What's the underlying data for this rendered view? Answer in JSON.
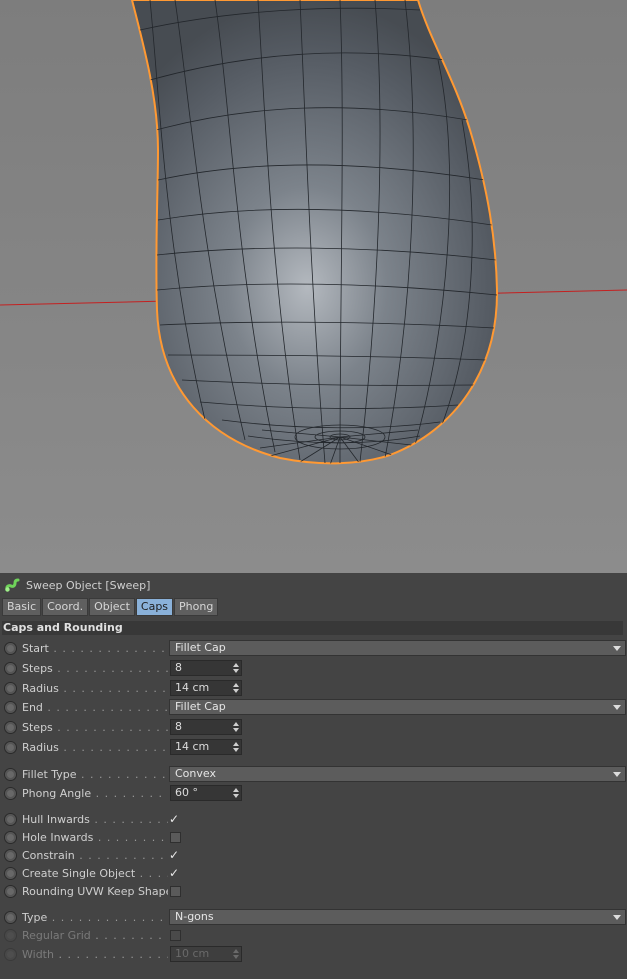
{
  "viewport": {
    "background": "#8a8a8a",
    "object_color": "#5d636b",
    "wire_color": "#22262b",
    "outline_color": "#ff9933",
    "axis_color": "#cc2020"
  },
  "panel": {
    "title": "Sweep Object [Sweep]",
    "icon": "sweep-object-icon",
    "tabs": [
      {
        "label": "Basic",
        "active": false
      },
      {
        "label": "Coord.",
        "active": false
      },
      {
        "label": "Object",
        "active": false
      },
      {
        "label": "Caps",
        "active": true
      },
      {
        "label": "Phong",
        "active": false
      }
    ],
    "section_title": "Caps and Rounding",
    "fields": {
      "start": {
        "label": "Start",
        "value": "Fillet Cap"
      },
      "start_steps": {
        "label": "Steps",
        "value": "8"
      },
      "start_radius": {
        "label": "Radius",
        "value": "14 cm"
      },
      "end": {
        "label": "End",
        "value": "Fillet Cap"
      },
      "end_steps": {
        "label": "Steps",
        "value": "8"
      },
      "end_radius": {
        "label": "Radius",
        "value": "14 cm"
      },
      "fillet_type": {
        "label": "Fillet Type",
        "value": "Convex"
      },
      "phong_angle": {
        "label": "Phong Angle",
        "value": "60 °"
      },
      "hull_inwards": {
        "label": "Hull Inwards",
        "checked": true
      },
      "hole_inwards": {
        "label": "Hole Inwards",
        "checked": false
      },
      "constrain": {
        "label": "Constrain",
        "checked": true
      },
      "create_single_object": {
        "label": "Create Single Object",
        "checked": true
      },
      "rounding_uvw": {
        "label": "Rounding UVW Keep Shape",
        "checked": false
      },
      "type": {
        "label": "Type",
        "value": "N-gons"
      },
      "regular_grid": {
        "label": "Regular Grid",
        "checked": false
      },
      "width": {
        "label": "Width",
        "value": "10 cm"
      }
    },
    "checkmark_glyph": "✓"
  }
}
